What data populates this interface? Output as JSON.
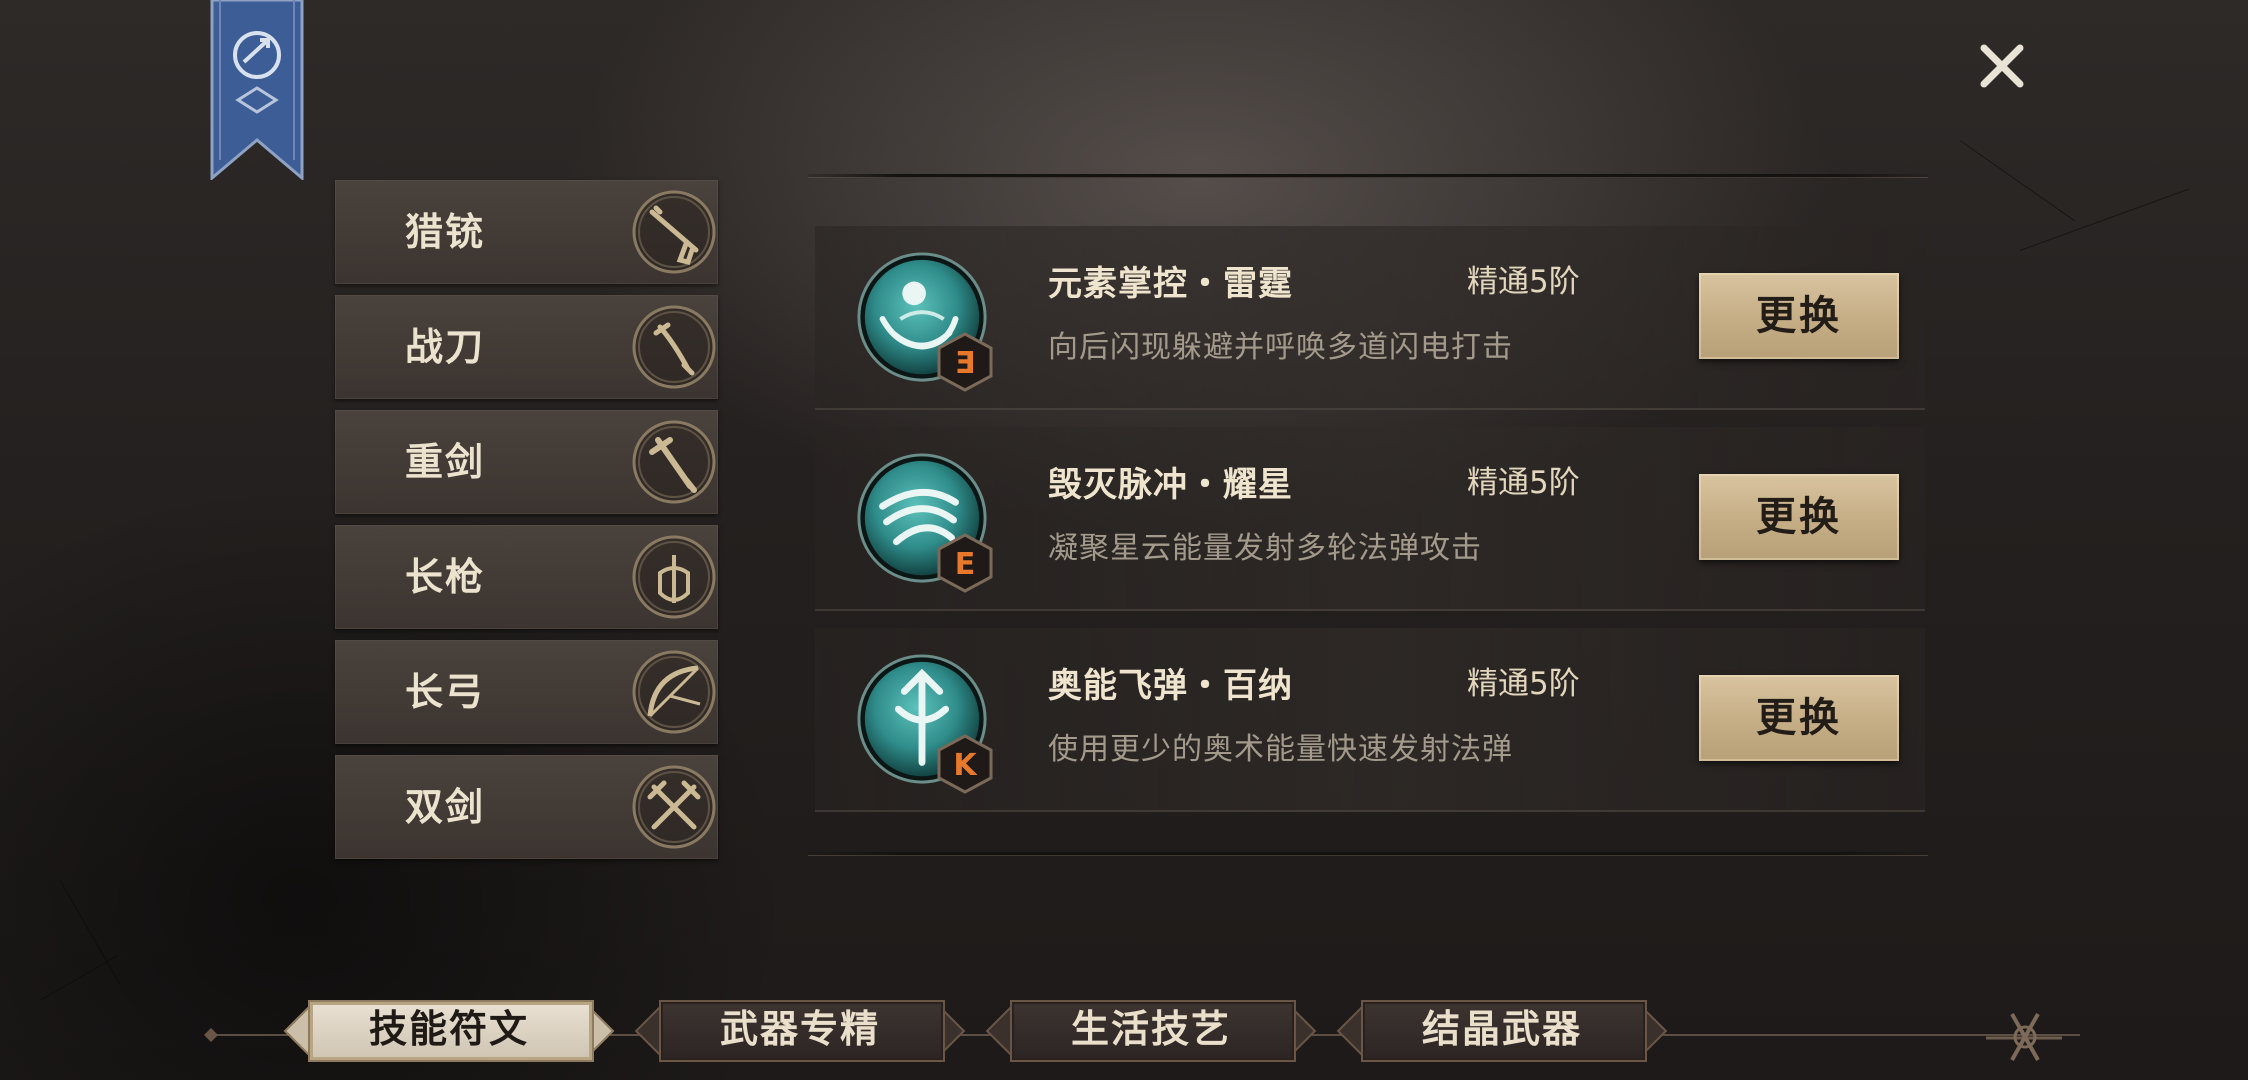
{
  "weapons": [
    {
      "label": "猎铳",
      "icon": "rifle-icon"
    },
    {
      "label": "战刀",
      "icon": "blade-icon"
    },
    {
      "label": "重剑",
      "icon": "greatsword-icon"
    },
    {
      "label": "长枪",
      "icon": "spear-icon"
    },
    {
      "label": "长弓",
      "icon": "longbow-icon"
    },
    {
      "label": "双剑",
      "icon": "dual-swords-icon"
    }
  ],
  "skills": [
    {
      "name": "元素掌控・雷霆",
      "level": "精通5阶",
      "desc": "向后闪现躲避并呼唤多道闪电打击",
      "rune": "Ǝ",
      "swap_label": "更换"
    },
    {
      "name": "毁灭脉冲・耀星",
      "level": "精通5阶",
      "desc": "凝聚星云能量发射多轮法弹攻击",
      "rune": "E",
      "swap_label": "更换"
    },
    {
      "name": "奥能飞弹・百纳",
      "level": "精通5阶",
      "desc": "使用更少的奥术能量快速发射法弹",
      "rune": "K",
      "swap_label": "更换"
    }
  ],
  "bottom_tabs": [
    {
      "label": "技能符文",
      "active": true
    },
    {
      "label": "武器专精",
      "active": false
    },
    {
      "label": "生活技艺",
      "active": false
    },
    {
      "label": "结晶武器",
      "active": false
    }
  ],
  "colors": {
    "accent_gold": "#c5ad85",
    "skill_orb": "#2f8c8a",
    "rune_orange": "#e8792a",
    "banner_blue": "#3c5d96"
  }
}
